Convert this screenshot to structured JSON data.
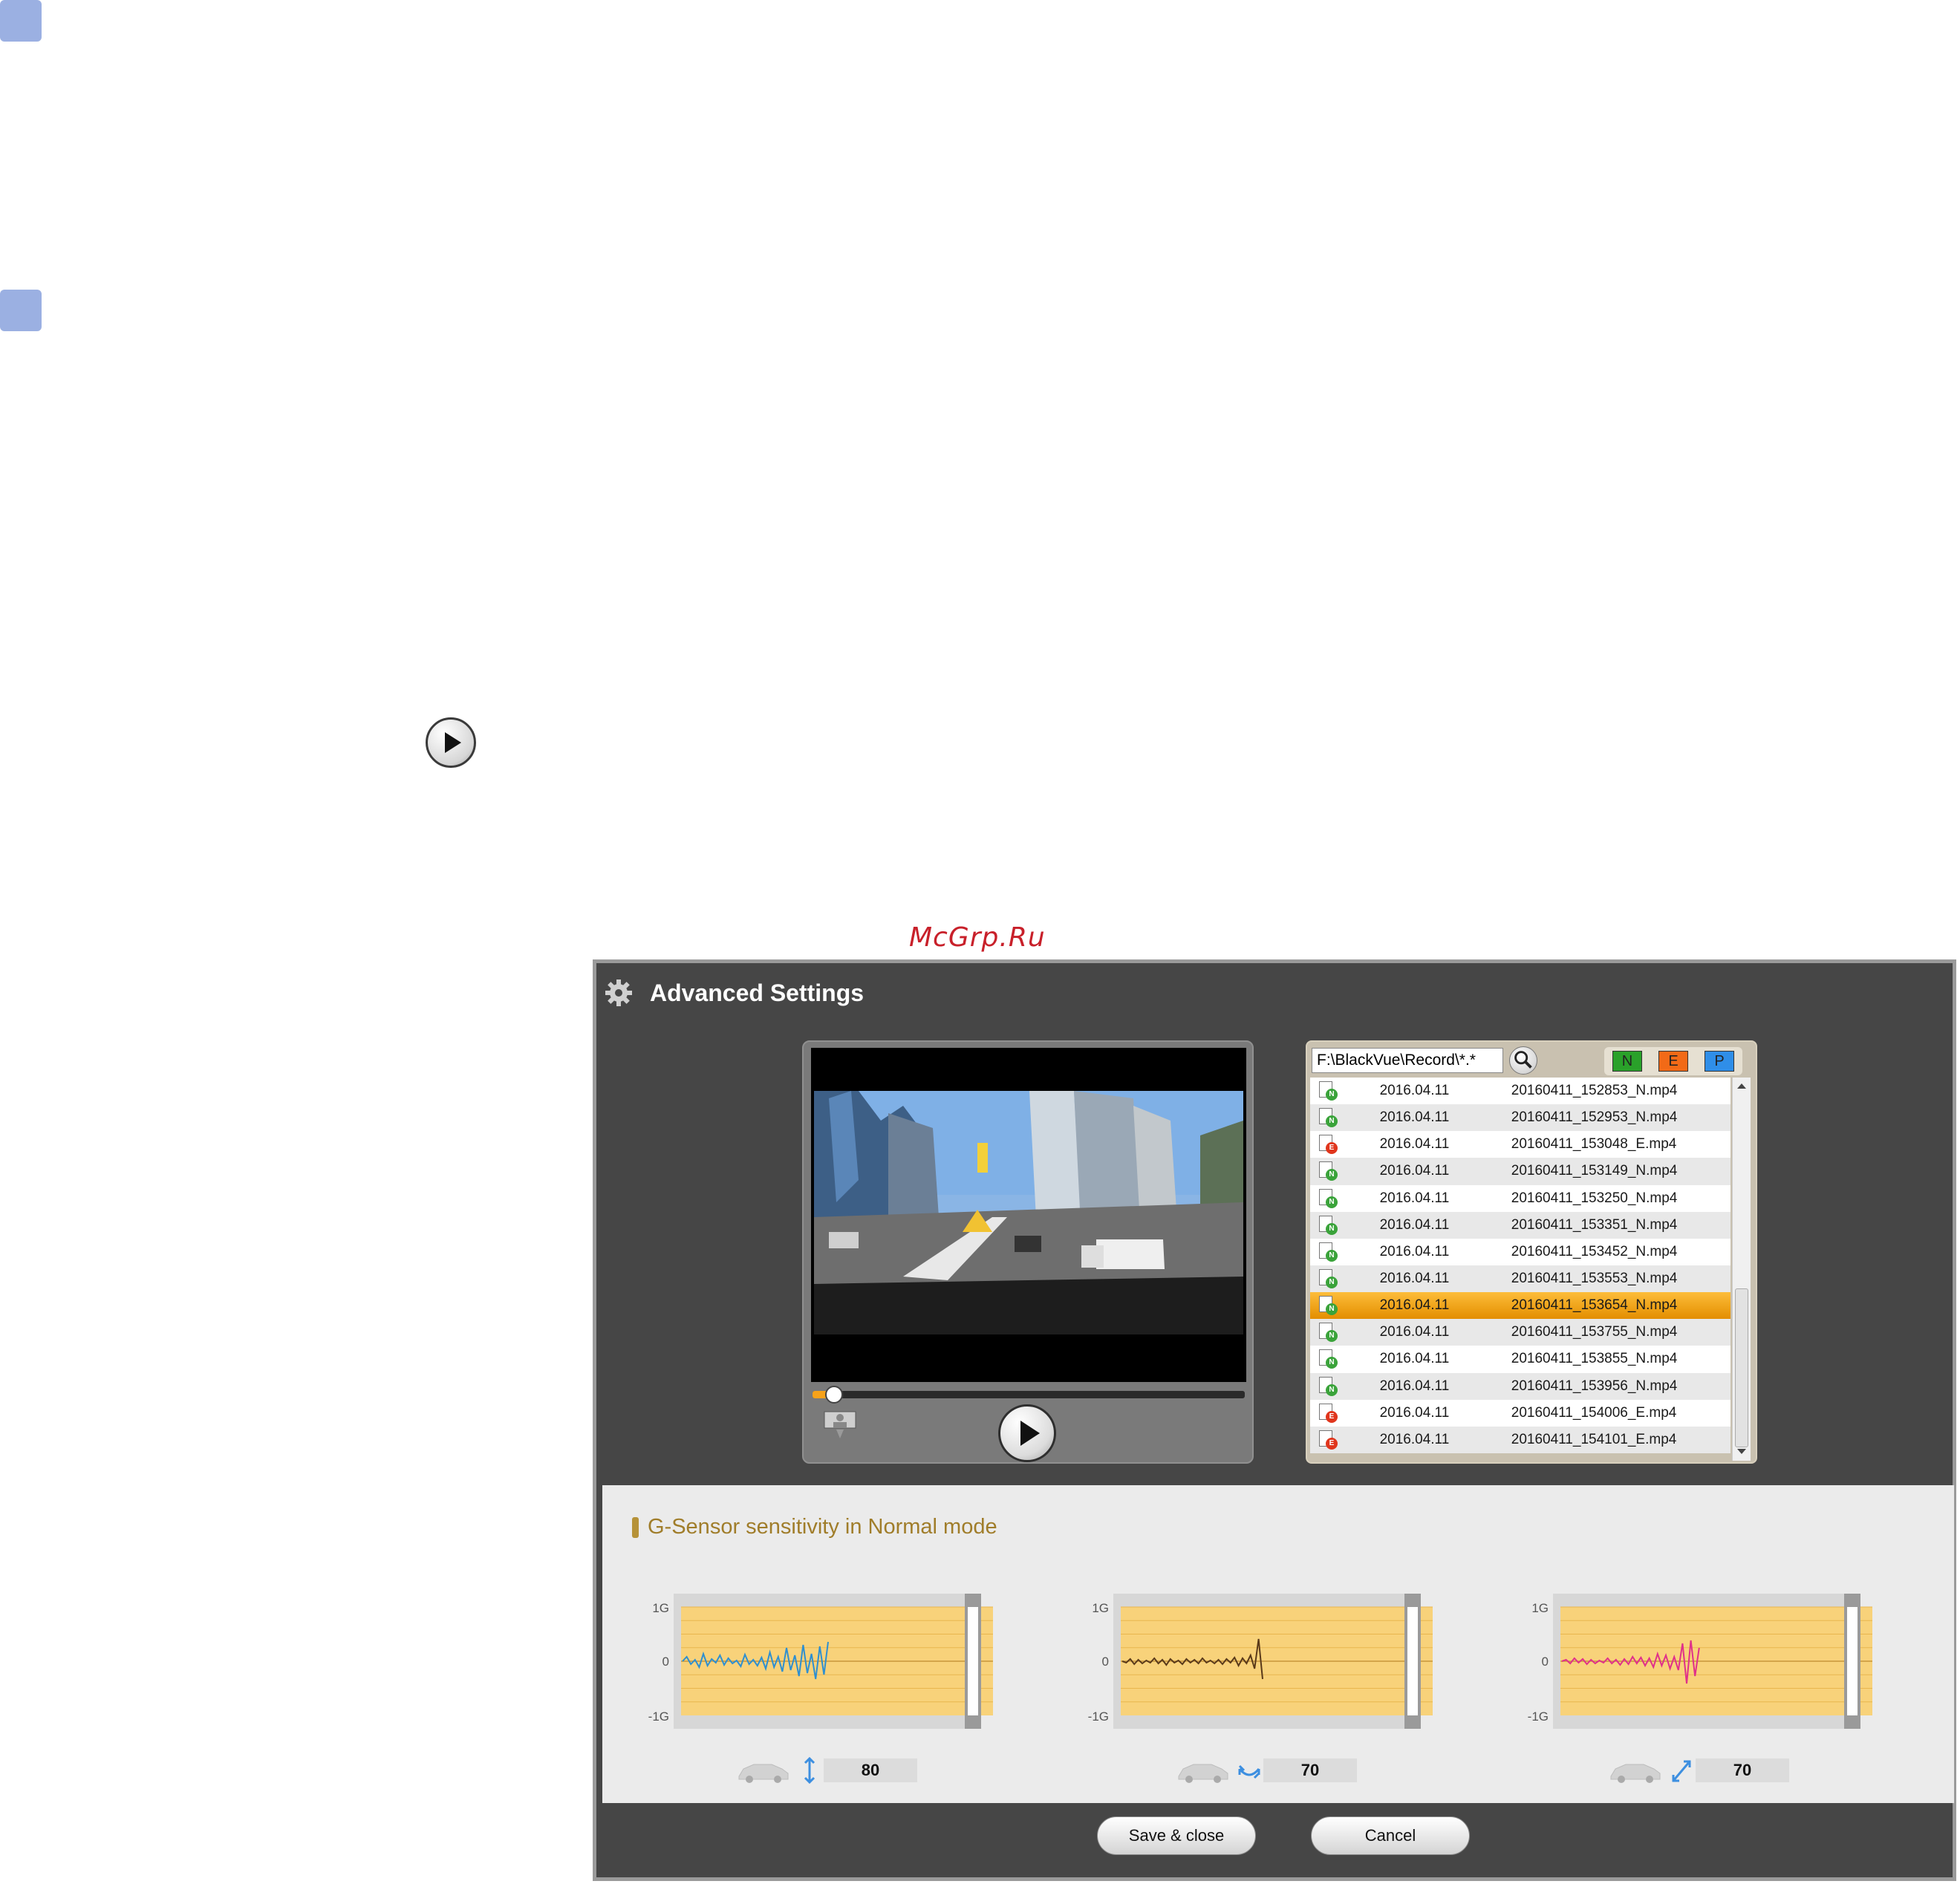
{
  "watermark": "McGrp.Ru",
  "dialog": {
    "title": "Advanced Settings",
    "icon": "gear-icon"
  },
  "player": {
    "progress_fraction": 0.05
  },
  "file_browser": {
    "path": "F:\\BlackVue\\Record\\*.*",
    "filters": [
      {
        "label": "N",
        "color": "#2aa12a"
      },
      {
        "label": "E",
        "color": "#f26a17"
      },
      {
        "label": "P",
        "color": "#2f8ee8"
      }
    ],
    "files": [
      {
        "date": "2016.04.11",
        "name": "20160411_152853_N.mp4",
        "type": "N"
      },
      {
        "date": "2016.04.11",
        "name": "20160411_152953_N.mp4",
        "type": "N"
      },
      {
        "date": "2016.04.11",
        "name": "20160411_153048_E.mp4",
        "type": "E"
      },
      {
        "date": "2016.04.11",
        "name": "20160411_153149_N.mp4",
        "type": "N"
      },
      {
        "date": "2016.04.11",
        "name": "20160411_153250_N.mp4",
        "type": "N"
      },
      {
        "date": "2016.04.11",
        "name": "20160411_153351_N.mp4",
        "type": "N"
      },
      {
        "date": "2016.04.11",
        "name": "20160411_153452_N.mp4",
        "type": "N"
      },
      {
        "date": "2016.04.11",
        "name": "20160411_153553_N.mp4",
        "type": "N"
      },
      {
        "date": "2016.04.11",
        "name": "20160411_153654_N.mp4",
        "type": "N",
        "selected": true
      },
      {
        "date": "2016.04.11",
        "name": "20160411_153755_N.mp4",
        "type": "N"
      },
      {
        "date": "2016.04.11",
        "name": "20160411_153855_N.mp4",
        "type": "N"
      },
      {
        "date": "2016.04.11",
        "name": "20160411_153956_N.mp4",
        "type": "N"
      },
      {
        "date": "2016.04.11",
        "name": "20160411_154006_E.mp4",
        "type": "E"
      },
      {
        "date": "2016.04.11",
        "name": "20160411_154101_E.mp4",
        "type": "E"
      }
    ]
  },
  "gsensor": {
    "title": "G-Sensor sensitivity in Normal mode",
    "y_ticks": [
      "1G",
      "0",
      "-1G"
    ],
    "axes": [
      {
        "name": "vertical",
        "value": "80",
        "line_color": "#2e8fd0",
        "icon": "vertical-arrow-icon"
      },
      {
        "name": "horizontal",
        "value": "70",
        "line_color": "#5a3a1a",
        "icon": "swap-arrow-icon"
      },
      {
        "name": "diagonal",
        "value": "70",
        "line_color": "#e0308a",
        "icon": "diagonal-arrow-icon"
      }
    ]
  },
  "buttons": {
    "save": "Save & close",
    "cancel": "Cancel"
  }
}
